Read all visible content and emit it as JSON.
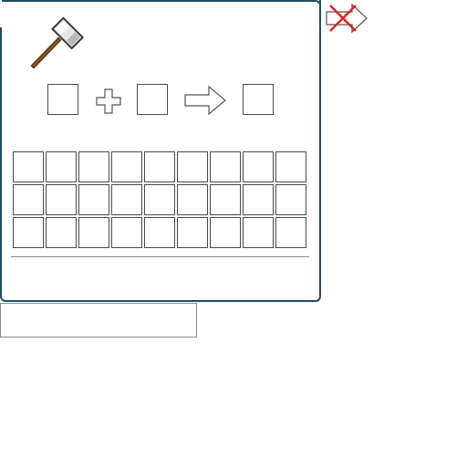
{
  "icons": {
    "tool": "hammer-icon",
    "combine": "plus-icon",
    "result": "arrow-right-icon",
    "close": "close-icon"
  },
  "crafting": {
    "input_slots": 2,
    "output_slots": 1
  },
  "inventory": {
    "rows": 3,
    "columns": 9
  },
  "name_input": {
    "value": "",
    "placeholder": ""
  },
  "colors": {
    "panel_border": "#1f4e63",
    "slot_border": "#4a4a4a",
    "close_x": "#e02020"
  }
}
